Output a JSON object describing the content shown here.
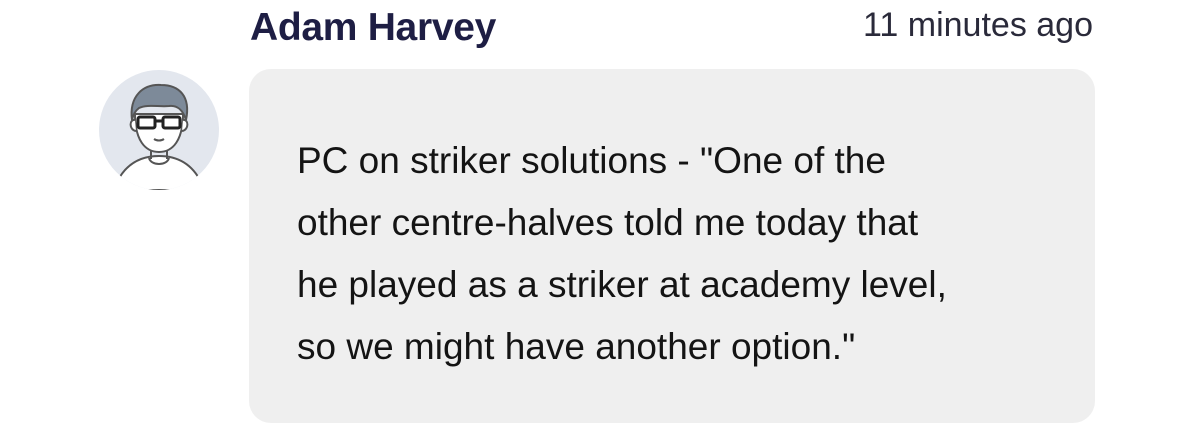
{
  "comment": {
    "author": "Adam Harvey",
    "timestamp": "11 minutes ago",
    "avatar_icon": "user-avatar-glasses-icon",
    "message_lines": [
      "PC on striker solutions - \"One of the",
      "other centre-halves told me today that",
      "he played as a striker at academy level,",
      "so we might have another option.\""
    ]
  },
  "colors": {
    "author": "#1e1e44",
    "bubble_background": "#efefef",
    "avatar_background": "#e3e7ee"
  }
}
